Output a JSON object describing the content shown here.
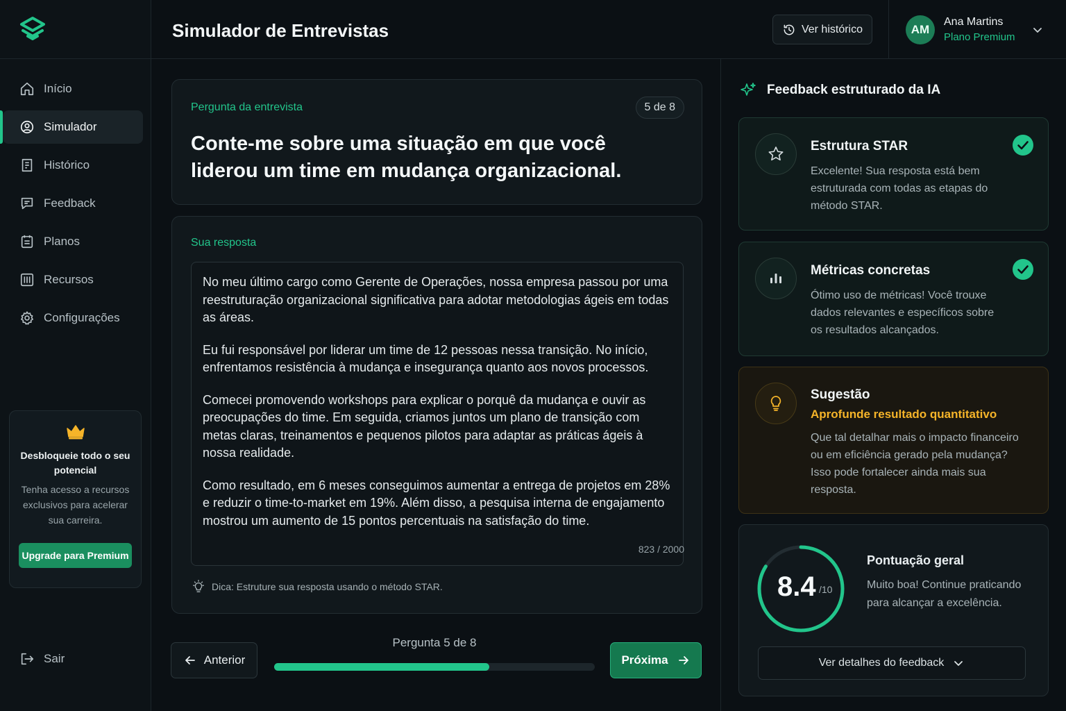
{
  "header": {
    "title": "Simulador de Entrevistas",
    "history_label": "Ver histórico",
    "user": {
      "initials": "AM",
      "name": "Ana Martins",
      "plan": "Plano Premium"
    }
  },
  "sidebar": {
    "items": [
      {
        "label": "Início",
        "icon": "home-icon"
      },
      {
        "label": "Simulador",
        "icon": "simulator-icon",
        "active": true
      },
      {
        "label": "Histórico",
        "icon": "history-doc-icon"
      },
      {
        "label": "Feedback",
        "icon": "chat-icon"
      },
      {
        "label": "Planos",
        "icon": "plans-icon"
      },
      {
        "label": "Recursos",
        "icon": "resources-icon"
      },
      {
        "label": "Configurações",
        "icon": "gear-icon"
      }
    ],
    "upgrade": {
      "title": "Desbloqueie todo o seu potencial",
      "text": "Tenha acesso a recursos exclusivos para acelerar sua carreira.",
      "button": "Upgrade para Premium"
    },
    "logout": "Sair"
  },
  "question": {
    "label": "Pergunta da entrevista",
    "badge": "5 de 8",
    "text": "Conte-me sobre uma situação em que você liderou um time em mudança organizacional."
  },
  "answer": {
    "label": "Sua resposta",
    "paragraphs": [
      "No meu último cargo como Gerente de Operações, nossa empresa passou por uma reestruturação organizacional significativa para adotar metodologias ágeis em todas as áreas.",
      "Eu fui responsável por liderar um time de 12 pessoas nessa transição. No início, enfrentamos resistência à mudança e insegurança quanto aos novos processos.",
      "Comecei promovendo workshops para explicar o porquê da mudança e ouvir as preocupações do time. Em seguida, criamos juntos um plano de transição com metas claras, treinamentos e pequenos pilotos para adaptar as práticas ágeis à nossa realidade.",
      "Como resultado, em 6 meses conseguimos aumentar a entrega de projetos em 28% e reduzir o time-to-market em 19%. Além disso, a pesquisa interna de engajamento mostrou um aumento de 15 pontos percentuais na satisfação do time."
    ],
    "char_count": "823 / 2000",
    "tip": "Dica: Estruture sua resposta usando o método STAR."
  },
  "navigation": {
    "prev": "Anterior",
    "next": "Próxima",
    "progress_prefix": "Pergunta ",
    "progress_current": "5",
    "progress_middle": " de ",
    "progress_total": "8",
    "progress_fraction": 0.67
  },
  "feedback": {
    "title": "Feedback estruturado da IA",
    "cards": [
      {
        "title": "Estrutura STAR",
        "text": "Excelente! Sua resposta está bem estruturada com todas as etapas do método STAR.",
        "icon": "star-icon"
      },
      {
        "title": "Métricas concretas",
        "text": "Ótimo uso de métricas! Você trouxe dados relevantes e específicos sobre os resultados alcançados.",
        "icon": "bar-chart-icon"
      }
    ],
    "suggestion": {
      "title": "Sugestão",
      "subtitle": "Aprofunde resultado quantitativo",
      "text": "Que tal detalhar mais o impacto financeiro ou em eficiência gerado pela mudança? Isso pode fortalecer ainda mais sua resposta."
    },
    "score": {
      "value": "8.4",
      "max": "/10",
      "fraction": 0.84,
      "title": "Pontuação geral",
      "text": "Muito boa! Continue praticando para alcançar a excelência.",
      "details_button": "Ver detalhes do feedback"
    }
  },
  "colors": {
    "accent": "#22c58b",
    "warning": "#f5b429",
    "background": "#0b1014"
  }
}
